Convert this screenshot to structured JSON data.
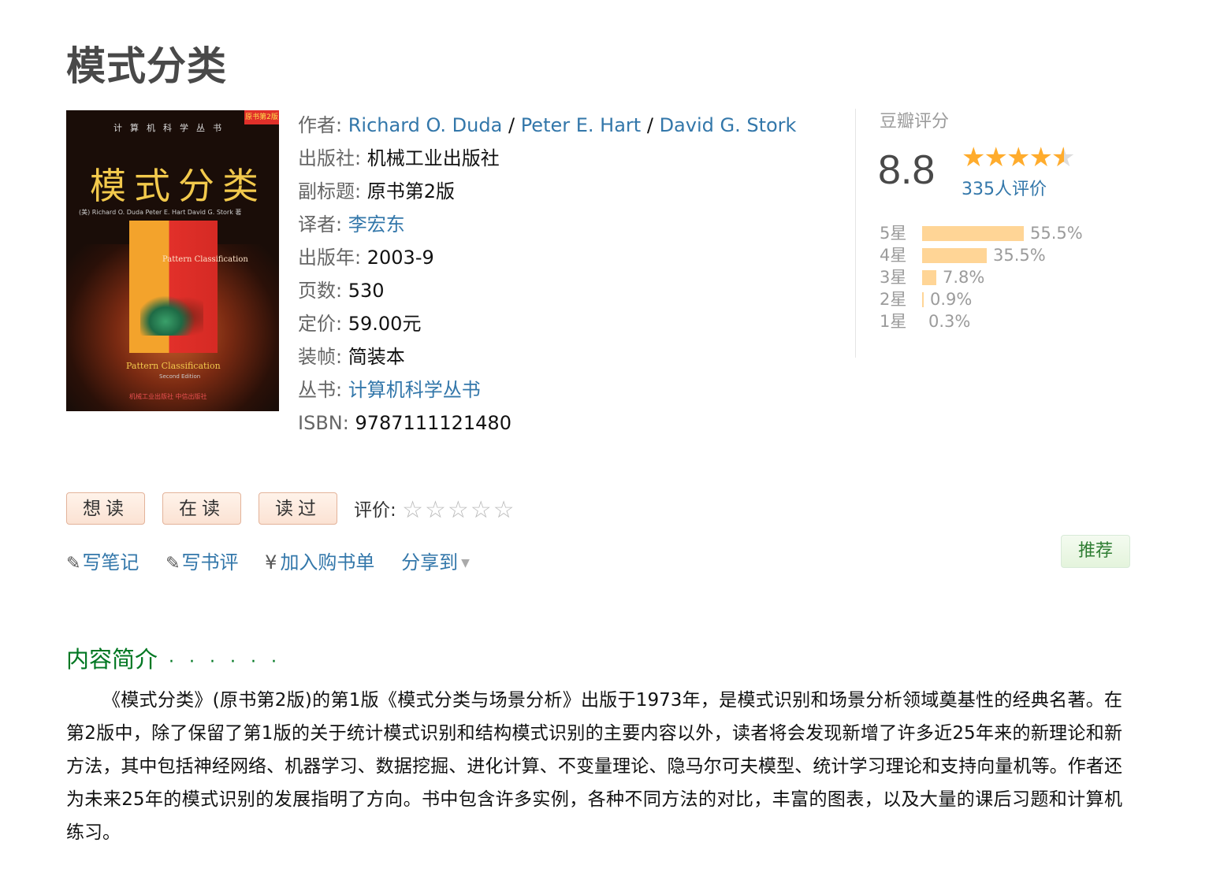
{
  "title": "模式分类",
  "cover": {
    "series": "计算机科学丛书",
    "badge": "原书第2版",
    "title": "模式分类",
    "authors": "(美) Richard O. Duda Peter E. Hart David G. Stork 著",
    "inner_text": "Pattern Classification",
    "bottom_title": "Pattern Classification",
    "bottom_sub": "Second Edition",
    "publisher": "机械工业出版社  中信出版社"
  },
  "info": {
    "author_label": "作者:",
    "authors": [
      "Richard O. Duda",
      "Peter E. Hart",
      "David G. Stork"
    ],
    "author_sep": "/",
    "publisher_label": "出版社:",
    "publisher": "机械工业出版社",
    "subtitle_label": "副标题:",
    "subtitle": "原书第2版",
    "translator_label": "译者:",
    "translator": "李宏东",
    "year_label": "出版年:",
    "year": "2003-9",
    "pages_label": "页数:",
    "pages": "530",
    "price_label": "定价:",
    "price": "59.00元",
    "binding_label": "装帧:",
    "binding": "简装本",
    "series_label": "丛书:",
    "series": "计算机科学丛书",
    "isbn_label": "ISBN:",
    "isbn": "9787111121480"
  },
  "rating": {
    "title": "豆瓣评分",
    "score": "8.8",
    "stars": 4.5,
    "count": "335人评价",
    "distribution": [
      {
        "label": "5星",
        "pct": "55.5%",
        "value": 55.5
      },
      {
        "label": "4星",
        "pct": "35.5%",
        "value": 35.5
      },
      {
        "label": "3星",
        "pct": "7.8%",
        "value": 7.8
      },
      {
        "label": "2星",
        "pct": "0.9%",
        "value": 0.9
      },
      {
        "label": "1星",
        "pct": "0.3%",
        "value": 0.3
      }
    ],
    "bar_color": "#ffd596",
    "star_color": "#ffac2d"
  },
  "actions": {
    "want": "想读",
    "reading": "在读",
    "read": "读过",
    "eval_label": "评价:",
    "eval_stars": "☆☆☆☆☆"
  },
  "links": {
    "note": "写笔记",
    "review": "写书评",
    "cart_symbol": "¥",
    "cart": "加入购书单",
    "share": "分享到",
    "recommend": "推荐"
  },
  "intro": {
    "title": "内容简介",
    "dots": "· · · · · ·",
    "text": "《模式分类》(原书第2版)的第1版《模式分类与场景分析》出版于1973年，是模式识别和场景分析领域奠基性的经典名著。在第2版中，除了保留了第1版的关于统计模式识别和结构模式识别的主要内容以外，读者将会发现新增了许多近25年来的新理论和新方法，其中包括神经网络、机器学习、数据挖掘、进化计算、不变量理论、隐马尔可夫模型、统计学习理论和支持向量机等。作者还为未来25年的模式识别的发展指明了方向。书中包含许多实例，各种不同方法的对比，丰富的图表，以及大量的课后习题和计算机练习。"
  }
}
